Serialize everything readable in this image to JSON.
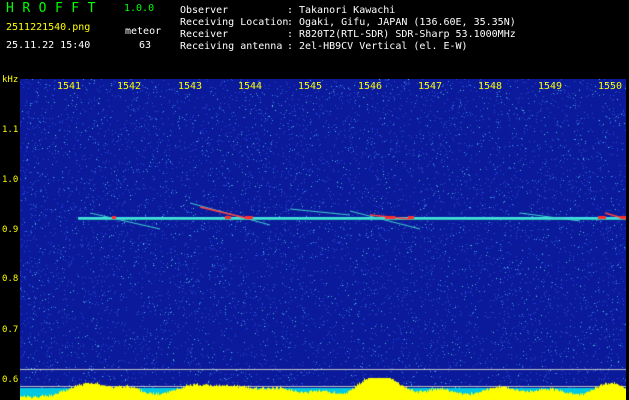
{
  "header": {
    "app_logo": "HROFFT",
    "app_version": "1.0.0",
    "filename": "2511221540.png",
    "datetime": "25.11.22 15:40",
    "meteor_label": "meteor",
    "meteor_count": "63"
  },
  "info": [
    {
      "key": "Observer",
      "value": "Takanori Kawachi"
    },
    {
      "key": "Receiving Location",
      "value": "Ogaki, Gifu, JAPAN (136.60E, 35.35N)"
    },
    {
      "key": "Receiver",
      "value": "R820T2(RTL-SDR) SDR-Sharp 53.1000MHz"
    },
    {
      "key": "Receiving antenna",
      "value": "2el-HB9CV Vertical (el. E-W)"
    }
  ],
  "info_separator": ":",
  "axes": {
    "y_unit": "kHz",
    "y_ticks": [
      "1.1",
      "1.0",
      "0.9",
      "0.8",
      "0.7",
      "0.6"
    ],
    "x_ticks": [
      "1541",
      "1542",
      "1543",
      "1544",
      "1545",
      "1546",
      "1547",
      "1548",
      "1549",
      "1550"
    ]
  },
  "colors": {
    "background": "#000000",
    "label_white": "#ffffff",
    "label_yellow": "#ffff00",
    "logo_green": "#00ff00",
    "noise_blue": "#0a1a9a",
    "signal_cyan": "#40e0e0",
    "signal_red": "#ff3030",
    "spectrum_yellow": "#ffff00"
  }
}
